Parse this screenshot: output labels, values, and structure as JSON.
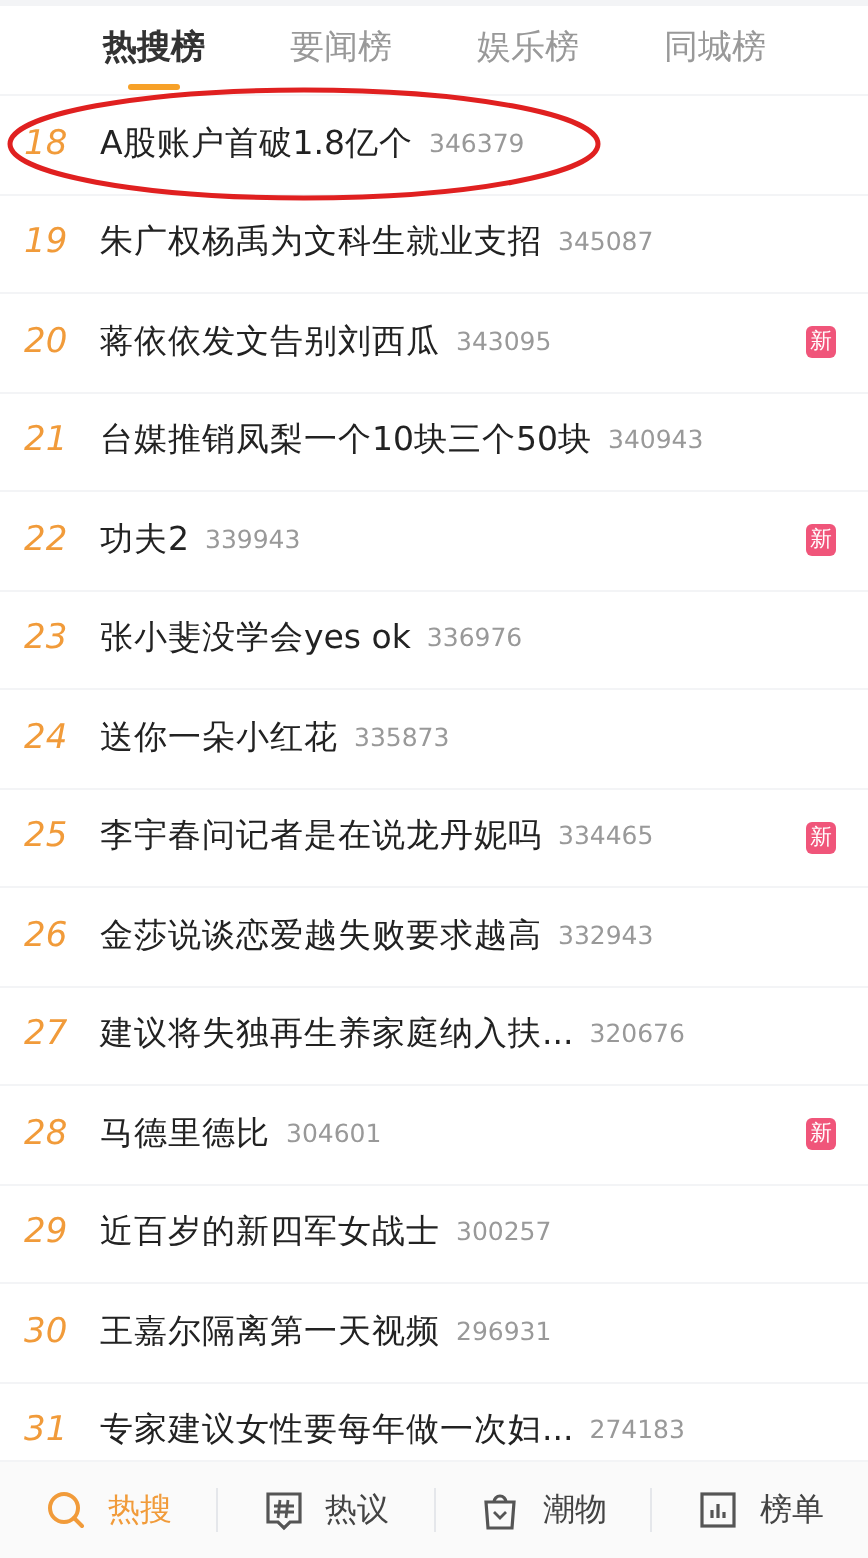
{
  "tabs": [
    {
      "label": "热搜榜",
      "selected": true
    },
    {
      "label": "要闻榜",
      "selected": false
    },
    {
      "label": "娱乐榜",
      "selected": false
    },
    {
      "label": "同城榜",
      "selected": false
    }
  ],
  "rows": [
    {
      "rank": "18",
      "title": "A股账户首破1.8亿个",
      "count": "346379",
      "circled": true
    },
    {
      "rank": "19",
      "title": "朱广权杨禹为文科生就业支招",
      "count": "345087",
      "circled": false
    },
    {
      "rank": "20",
      "title": "蒋依依发文告别刘西瓜",
      "count": "343095",
      "badge": "新",
      "circled": false
    },
    {
      "rank": "21",
      "title": "台媒推销凤梨一个10块三个50块",
      "count": "340943",
      "circled": false
    },
    {
      "rank": "22",
      "title": "功夫2",
      "count": "339943",
      "badge": "新",
      "circled": false
    },
    {
      "rank": "23",
      "title": "张小斐没学会yes ok",
      "count": "336976",
      "circled": false
    },
    {
      "rank": "24",
      "title": "送你一朵小红花",
      "count": "335873",
      "circled": false
    },
    {
      "rank": "25",
      "title": "李宇春问记者是在说龙丹妮吗",
      "count": "334465",
      "badge": "新",
      "circled": false
    },
    {
      "rank": "26",
      "title": "金莎说谈恋爱越失败要求越高",
      "count": "332943",
      "circled": false
    },
    {
      "rank": "27",
      "title": "建议将失独再生养家庭纳入扶...",
      "count": "320676",
      "circled": false
    },
    {
      "rank": "28",
      "title": "马德里德比",
      "count": "304601",
      "badge": "新",
      "circled": false
    },
    {
      "rank": "29",
      "title": "近百岁的新四军女战士",
      "count": "300257",
      "circled": false
    },
    {
      "rank": "30",
      "title": "王嘉尔隔离第一天视频",
      "count": "296931",
      "circled": false
    },
    {
      "rank": "31",
      "title": "专家建议女性要每年做一次妇...",
      "count": "274183",
      "circled": false
    }
  ],
  "bottom_nav": [
    {
      "kind": "search",
      "label": "热搜",
      "selected": true
    },
    {
      "kind": "discuss",
      "label": "热议",
      "selected": false
    },
    {
      "kind": "bag",
      "label": "潮物",
      "selected": false
    },
    {
      "kind": "chart",
      "label": "榜单",
      "selected": false
    }
  ]
}
